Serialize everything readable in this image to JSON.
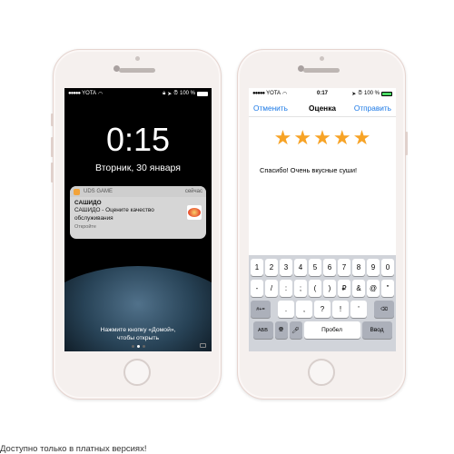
{
  "left_phone": {
    "status": {
      "carrier": "YOTA",
      "battery": "100 %",
      "battery_level": 1.0
    },
    "time": "0:15",
    "date": "Вторник, 30 января",
    "notification": {
      "app_name": "UDS GAME",
      "time": "сейчас",
      "title": "САШИДО",
      "message": "САШИДО - Оцените качество обслуживания",
      "hint": "Откройте"
    },
    "unlock_hint_line1": "Нажмите кнопку «Домой»,",
    "unlock_hint_line2": "чтобы открыть"
  },
  "right_phone": {
    "status": {
      "carrier": "YOTA",
      "time": "0:17",
      "battery": "100 %",
      "battery_level": 1.0
    },
    "nav": {
      "cancel": "Отменить",
      "title": "Оценка",
      "send": "Отправить"
    },
    "rating": {
      "value": 5,
      "max": 5,
      "star_color": "#f7a326"
    },
    "review_text": "Спасибо! Очень вкусные суши!",
    "keyboard": {
      "row1": [
        "1",
        "2",
        "3",
        "4",
        "5",
        "6",
        "7",
        "8",
        "9",
        "0"
      ],
      "row2": [
        "-",
        "/",
        ":",
        ";",
        "(",
        ")",
        "₽",
        "&",
        "@",
        "\""
      ],
      "row3_left": "#+=",
      "row3": [
        ".",
        ",",
        "?",
        "!",
        "'"
      ],
      "row4": {
        "abc": "АБВ",
        "space": "Пробел",
        "enter": "Ввод"
      }
    }
  },
  "footer": "Доступно только в платных версиях!",
  "colors": {
    "link": "#1a78e6",
    "keyboard_bg": "#d1d4da",
    "phone_body": "#f5f0ee"
  }
}
